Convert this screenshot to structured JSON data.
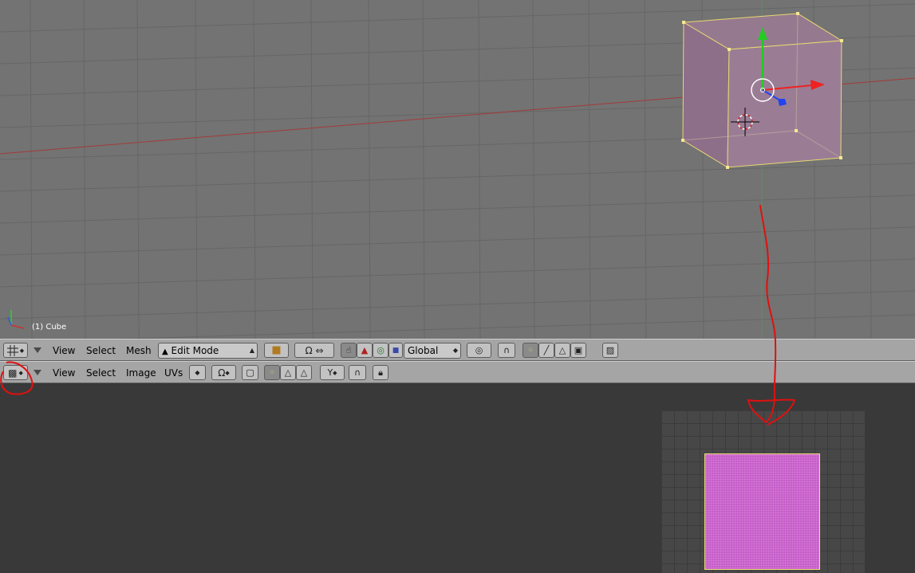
{
  "viewport3d": {
    "object_label": "(1) Cube",
    "background": "#737373",
    "axis_x_color": "#b03a3a",
    "axis_y_color": "#5aa05a"
  },
  "header_3d": {
    "menus": [
      "View",
      "Select",
      "Mesh"
    ],
    "mode_select": "Edit Mode",
    "orientation_select": "Global",
    "icons": [
      "grid-editor-icon",
      "shading-icon",
      "pivot-icon",
      "manipulator-hand-icon",
      "translate-icon",
      "rotate-icon",
      "scale-icon",
      "proportional-icon",
      "snap-icon",
      "vertex-select-icon",
      "edge-select-icon",
      "face-select-icon",
      "occlude-icon",
      "render-icon"
    ]
  },
  "header_image": {
    "menus": [
      "View",
      "Select",
      "Image",
      "UVs"
    ],
    "icons": [
      "image-editor-icon",
      "pivot-icon",
      "sticky-icon",
      "uv-sync-icon",
      "vertex-select-icon",
      "edge-select-icon",
      "face-select-icon",
      "y-fork-icon",
      "snap-icon",
      "lock-icon"
    ]
  },
  "uv_editor": {
    "face_color": "#c55ec8",
    "edge_color": "#f0e07a"
  },
  "annotation": {
    "stroke_color": "#e01010"
  }
}
